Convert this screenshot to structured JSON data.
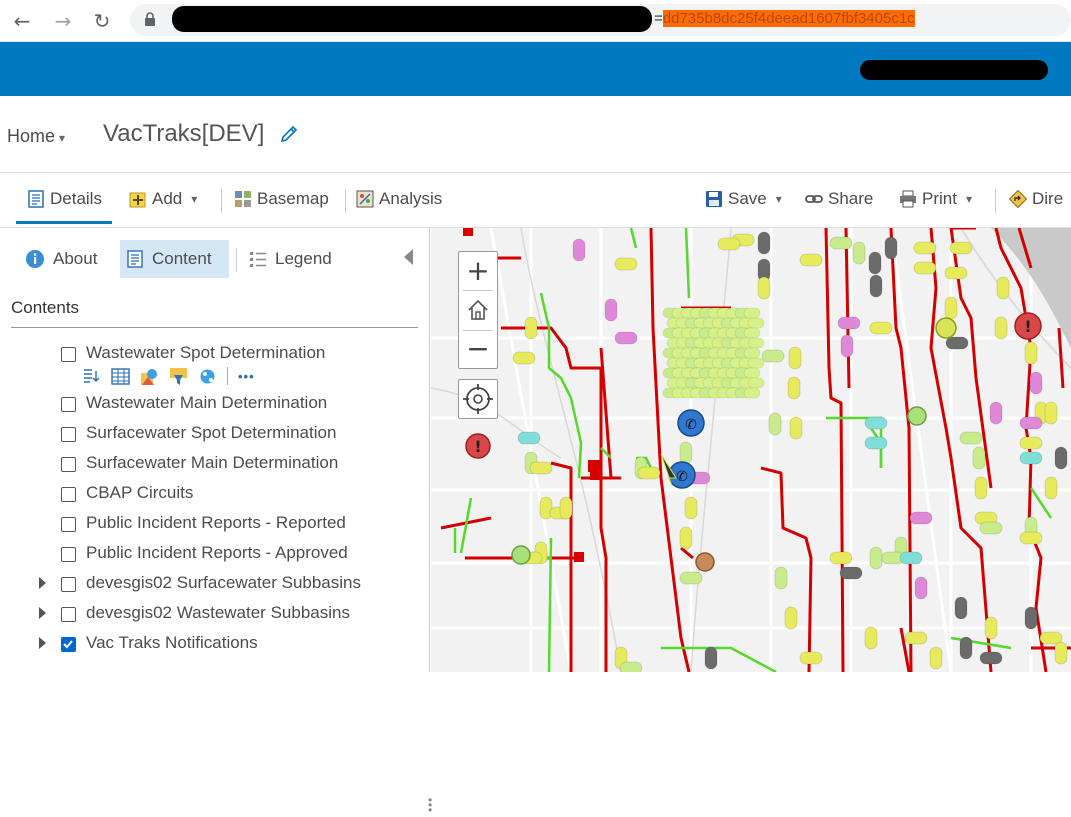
{
  "browser": {
    "url_suffix": "=",
    "url_highlight": "dd735b8dc25f4deead1607fbf3405c1c"
  },
  "header": {
    "home_label": "Home",
    "app_title": "VacTraks[DEV]"
  },
  "toolbar": {
    "details": "Details",
    "add": "Add",
    "basemap": "Basemap",
    "analysis": "Analysis",
    "save": "Save",
    "share": "Share",
    "print": "Print",
    "directions": "Dire"
  },
  "sidebar": {
    "tabs": {
      "about": "About",
      "content": "Content",
      "legend": "Legend"
    },
    "contents_heading": "Contents",
    "layers": [
      {
        "label": "Wastewater Spot Determination",
        "checked": false,
        "expandable": false
      },
      {
        "label": "Wastewater Main Determination",
        "checked": false,
        "expandable": false
      },
      {
        "label": "Surfacewater Spot Determination",
        "checked": false,
        "expandable": false
      },
      {
        "label": "Surfacewater Main Determination",
        "checked": false,
        "expandable": false
      },
      {
        "label": "CBAP Circuits",
        "checked": false,
        "expandable": false
      },
      {
        "label": "Public Incident Reports - Reported",
        "checked": false,
        "expandable": false
      },
      {
        "label": "Public Incident Reports - Approved",
        "checked": false,
        "expandable": false
      },
      {
        "label": "devesgis02 Surfacewater Subbasins",
        "checked": false,
        "expandable": true
      },
      {
        "label": "devesgis02 Wastewater Subbasins",
        "checked": false,
        "expandable": true
      },
      {
        "label": "Vac Traks Notifications",
        "checked": true,
        "expandable": true
      }
    ],
    "layer_tools": [
      "show-item-details-icon",
      "show-table-icon",
      "change-style-icon",
      "filter-icon",
      "perform-analysis-icon",
      "more-options-icon"
    ],
    "more_label": "•••"
  },
  "map": {
    "zoom_in": "+",
    "zoom_out": "−"
  },
  "colors": {
    "brand_blue": "#0079c1",
    "pipe_red": "#d40000",
    "pipe_green": "#55d92a",
    "marker_yellow": "#e6ea5c",
    "marker_lightgreen": "#c8ec8c",
    "marker_gray": "#6b6b6b",
    "marker_pink": "#e088d8",
    "marker_teal": "#7fded8"
  }
}
